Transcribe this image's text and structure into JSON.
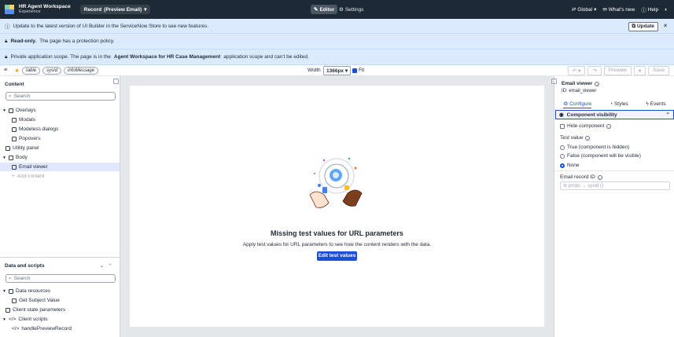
{
  "topbar": {
    "app_name": "HR Agent Workspace",
    "app_sub": "Experience",
    "record_label": "Record",
    "record_variant": "(Preview Email)",
    "editor": "Editor",
    "settings": "Settings",
    "scope": "Global",
    "whats_new": "What's new",
    "help": "Help"
  },
  "banners": {
    "update_text": "Update to the latest version of UI Builder in the ServiceNow Store to see new features.",
    "update_button": "Update",
    "readonly_bold": "Read-only.",
    "readonly_text": "The page has a protection policy.",
    "scope_text_1": "Private application scope. The page is in the",
    "scope_app": "Agent Workspace for HR Case Management",
    "scope_text_2": "application scope and can't be edited."
  },
  "toolbar": {
    "chips": [
      "table",
      "sysId",
      "infoMessage"
    ],
    "width_label": "Width",
    "width_value": "1366px",
    "fit_label": "Fit",
    "preview": "Preview",
    "save": "Save"
  },
  "left": {
    "content_title": "Content",
    "search_placeholder": "Search",
    "tree": {
      "overlays": "Overlays",
      "modals": "Modals",
      "modeless": "Modeless dialogs",
      "popovers": "Popovers",
      "utility": "Utility panel",
      "body": "Body",
      "email_viewer": "Email viewer",
      "add_content": "Add content"
    },
    "data_title": "Data and scripts",
    "data_search_placeholder": "Search",
    "data_tree": {
      "data_resources": "Data resources",
      "get_subject": "Get Subject Value",
      "client_state": "Client state parameters",
      "client_scripts": "Client scripts",
      "handle_preview": "handlePreviewRecord"
    }
  },
  "canvas": {
    "empty_title": "Missing test values for URL parameters",
    "empty_sub": "Apply test values for URL parameters to see how the content renders with the data.",
    "edit_button": "Edit test values"
  },
  "right": {
    "component_title": "Email viewer",
    "component_id": "ID: email_viewer",
    "tabs": [
      "Configure",
      "Styles",
      "Events"
    ],
    "section": "Component visibility",
    "hide_component": "Hide component",
    "test_value": "Test value",
    "options": [
      "True (component is hidden)",
      "False (component will be visible)",
      "None"
    ],
    "selected_option": 2,
    "email_record_label": "Email record ID",
    "email_record_placeholder": "props → sysId ()"
  },
  "colors": {
    "topbar": "#1d2a36",
    "accent": "#1d4ed8",
    "banner": "#dbeafe"
  }
}
